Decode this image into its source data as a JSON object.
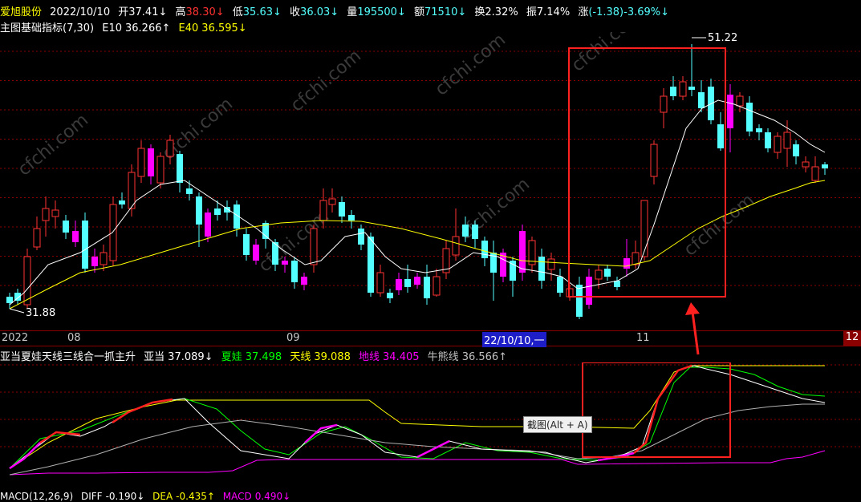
{
  "header": {
    "stock_name": "爱旭股份",
    "date": "2022/10/10",
    "open_label": "开",
    "open_value": "37.41↓",
    "high_label": "高",
    "high_value": "38.30↓",
    "low_label": "低",
    "low_value": "35.63↓",
    "close_label": "收",
    "close_value": "36.03↓",
    "volume_label": "量",
    "volume_value": "195500↓",
    "amount_label": "额",
    "amount_value": "71510↓",
    "turnover_label": "换",
    "turnover_value": "2.32%",
    "amplitude_label": "振",
    "amplitude_value": "7.14%",
    "change_label": "涨",
    "change_value": "(-1.38)-3.69%↓"
  },
  "indicator_bar": {
    "name": "主图基础指标(7,30)",
    "e10_label": "E10",
    "e10_value": "36.266↑",
    "e40_label": "E40",
    "e40_value": "36.595↓"
  },
  "main_chart": {
    "peak_label": "51.22",
    "low_label": "31.88",
    "watermark": "cfchi.com"
  },
  "date_axis": {
    "labels": [
      "2022",
      "08",
      "09",
      "11"
    ],
    "highlight": "22/10/10,一",
    "right_marker": "12"
  },
  "lower_panel": {
    "title": "亚当夏娃天线三线合一抓主升",
    "yadang_label": "亚当",
    "yadang_value": "37.089↓",
    "xiawa_label": "夏娃",
    "xiawa_value": "37.498",
    "tianxian_label": "天线",
    "tianxian_value": "39.088",
    "dixian_label": "地线",
    "dixian_value": "34.405",
    "niuxiong_label": "牛熊线",
    "niuxiong_value": "36.566↑"
  },
  "macd_bar": {
    "macd_label": "MACD(12,26,9)",
    "diff_label": "DIFF",
    "diff_value": "-0.190↓",
    "dea_label": "DEA",
    "dea_value": "-0.435↑",
    "macd_value_label": "MACD",
    "macd_value": "0.490↓"
  },
  "tooltip": {
    "text": "截图(Alt + A)"
  },
  "colors": {
    "up": "#ff3232",
    "down": "#54ffff",
    "ma_white": "#ffffff",
    "ma_yellow": "#ffff00",
    "grid": "#8b0000",
    "xiawa": "#00ff00",
    "dixian": "#ff00ff",
    "niuxiong": "#c0c0c0",
    "annotation": "#ff2020"
  }
}
